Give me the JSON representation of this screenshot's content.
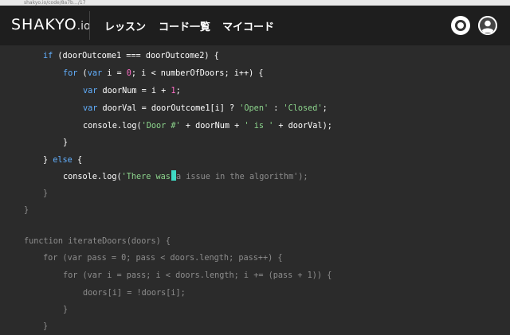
{
  "browser": {
    "url_text": "shakyo.io/code/8a7b…/17"
  },
  "header": {
    "logo_main": "SHAKYO",
    "logo_suffix": ".io",
    "nav": [
      "レッスン",
      "コード一覧",
      "マイコード"
    ],
    "icons": [
      "theme-toggle-icon",
      "user-account-icon"
    ]
  },
  "code": {
    "lines": [
      [
        [
          "kw",
          "if"
        ],
        [
          "pl",
          " (doorOutcome1 === doorOutcome2) {"
        ]
      ],
      [
        [
          "kw",
          "for"
        ],
        [
          "pl",
          " ("
        ],
        [
          "kw",
          "var"
        ],
        [
          "pl",
          " i = "
        ],
        [
          "num",
          "0"
        ],
        [
          "pl",
          "; i < numberOfDoors; i++) {"
        ]
      ],
      [
        [
          "kw",
          "var"
        ],
        [
          "pl",
          " doorNum = i + "
        ],
        [
          "num",
          "1"
        ],
        [
          "pl",
          ";"
        ]
      ],
      [
        [
          "kw",
          "var"
        ],
        [
          "pl",
          " doorVal = doorOutcome1[i] ? "
        ],
        [
          "str",
          "'Open'"
        ],
        [
          "pl",
          " : "
        ],
        [
          "str",
          "'Closed'"
        ],
        [
          "pl",
          ";"
        ]
      ],
      [
        [
          "pl",
          "console.log("
        ],
        [
          "str",
          "'Door #'"
        ],
        [
          "pl",
          " + doorNum + "
        ],
        [
          "str",
          "' is '"
        ],
        [
          "pl",
          " + doorVal);"
        ]
      ],
      [
        [
          "pl",
          "}"
        ]
      ],
      [
        [
          "pl",
          "} "
        ],
        [
          "kw",
          "else"
        ],
        [
          "pl",
          " {"
        ]
      ],
      [
        [
          "pl",
          "console.log("
        ],
        [
          "typed",
          "'There was"
        ],
        [
          "cursor",
          ""
        ],
        [
          "rest",
          "a issue in the algorithm');"
        ]
      ],
      [
        [
          "rest",
          "}"
        ]
      ],
      [
        [
          "rest",
          "}"
        ]
      ],
      [
        [
          "rest",
          ""
        ]
      ],
      [
        [
          "rest",
          "function iterateDoors(doors) {"
        ]
      ],
      [
        [
          "rest",
          "for (var pass = 0; pass < doors.length; pass++) {"
        ]
      ],
      [
        [
          "rest",
          "for (var i = pass; i < doors.length; i += (pass + 1)) {"
        ]
      ],
      [
        [
          "rest",
          "doors[i] = !doors[i];"
        ]
      ],
      [
        [
          "rest",
          "}"
        ]
      ],
      [
        [
          "rest",
          "}"
        ]
      ]
    ]
  }
}
